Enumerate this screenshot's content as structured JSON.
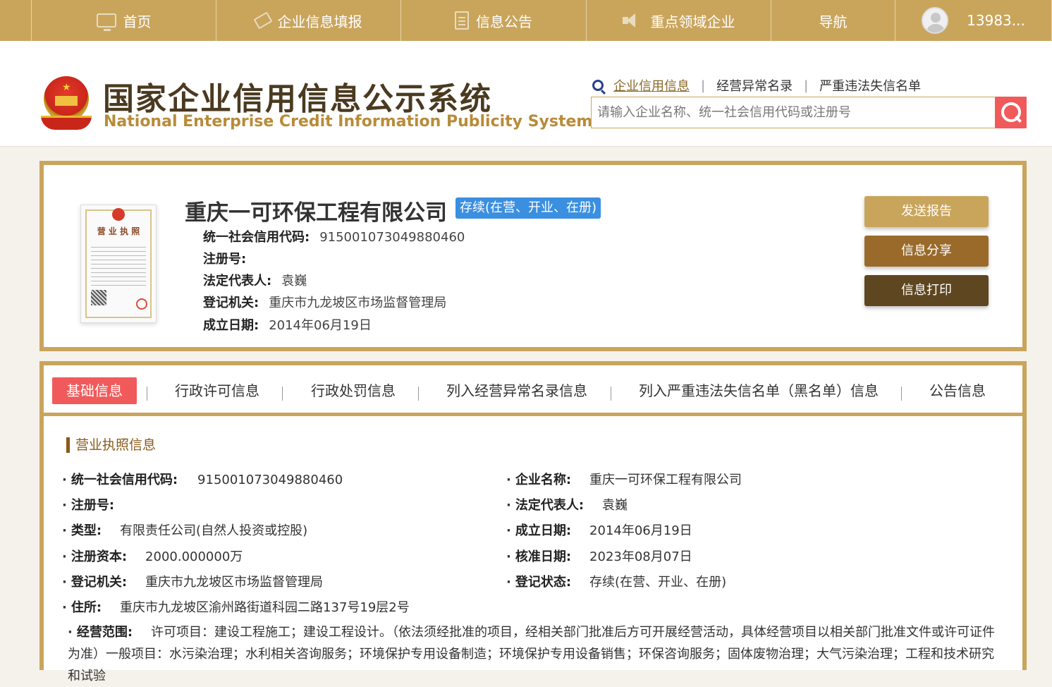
{
  "topnav": {
    "items": [
      {
        "label": "首页",
        "icon": "monitor-icon"
      },
      {
        "label": "企业信息填报",
        "icon": "pen-icon"
      },
      {
        "label": "信息公告",
        "icon": "document-icon"
      },
      {
        "label": "重点领域企业",
        "icon": "speaker-icon"
      },
      {
        "label": "导航"
      }
    ],
    "user": "13983..."
  },
  "header": {
    "title_cn": "国家企业信用信息公示系统",
    "title_en": "National Enterprise Credit Information Publicity System",
    "links": [
      "企业信用信息",
      "经营异常名录",
      "严重违法失信名单"
    ],
    "search_placeholder": "请输入企业名称、统一社会信用代码或注册号"
  },
  "company": {
    "name": "重庆一可环保工程有限公司",
    "status": "存续(在营、开业、在册)",
    "license_title": "营 业 执 照",
    "fields": [
      {
        "key": "统一社会信用代码:",
        "value": "915001073049880460"
      },
      {
        "key": "注册号:",
        "value": ""
      },
      {
        "key": "法定代表人:",
        "value": "袁巍"
      },
      {
        "key": "登记机关:",
        "value": "重庆市九龙坡区市场监督管理局"
      },
      {
        "key": "成立日期:",
        "value": "2014年06月19日"
      }
    ],
    "buttons": [
      "发送报告",
      "信息分享",
      "信息打印"
    ]
  },
  "tabs": [
    "基础信息",
    "行政许可信息",
    "行政处罚信息",
    "列入经营异常名录信息",
    "列入严重违法失信名单（黑名单）信息",
    "公告信息"
  ],
  "detail": {
    "section_title": "营业执照信息",
    "left": [
      {
        "key": "统一社会信用代码:",
        "value": "915001073049880460"
      },
      {
        "key": "注册号:",
        "value": ""
      },
      {
        "key": "类型:",
        "value": "有限责任公司(自然人投资或控股)"
      },
      {
        "key": "注册资本:",
        "value": "2000.000000万"
      },
      {
        "key": "登记机关:",
        "value": "重庆市九龙坡区市场监督管理局"
      },
      {
        "key": "住所:",
        "value": "重庆市九龙坡区渝州路街道科园二路137号19层2号"
      }
    ],
    "right": [
      {
        "key": "企业名称:",
        "value": "重庆一可环保工程有限公司"
      },
      {
        "key": "法定代表人:",
        "value": "袁巍"
      },
      {
        "key": "成立日期:",
        "value": "2014年06月19日"
      },
      {
        "key": "核准日期:",
        "value": "2023年08月07日"
      },
      {
        "key": "登记状态:",
        "value": "存续(在营、开业、在册)"
      }
    ],
    "scope_key": "经营范围:",
    "scope_value": "许可项目：建设工程施工；建设工程设计。（依法须经批准的项目，经相关部门批准后方可开展经营活动，具体经营项目以相关部门批准文件或许可证件为准）一般项目：水污染治理；水利相关咨询服务；环境保护专用设备制造；环境保护专用设备销售；环保咨询服务；固体废物治理；大气污染治理；工程和技术研究和试验"
  }
}
